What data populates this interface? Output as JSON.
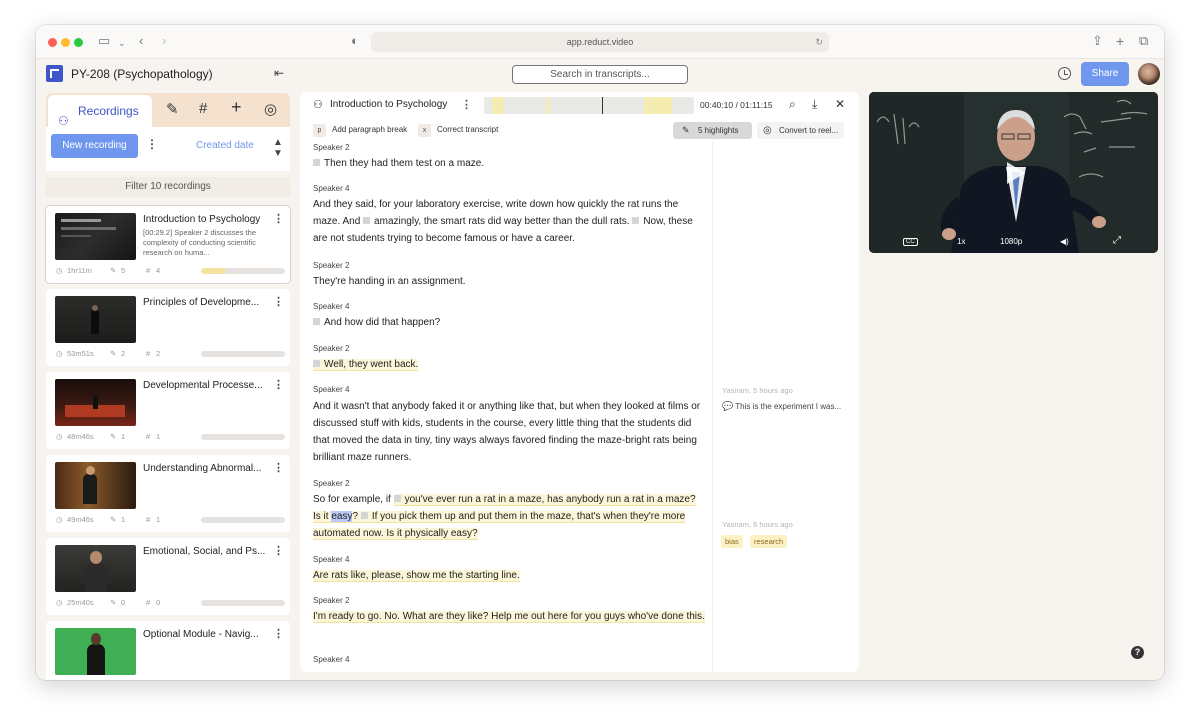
{
  "browser": {
    "url": "app.reduct.video"
  },
  "header": {
    "project_title": "PY-208 (Psychopathology)",
    "search_placeholder": "Search in transcripts...",
    "share_label": "Share"
  },
  "sidebar": {
    "tab_recordings": "Recordings",
    "new_recording": "New recording",
    "sort_label": "Created date",
    "filter_label": "Filter 10 recordings",
    "recordings": [
      {
        "title": "Introduction to Psychology",
        "desc": "[00:29.2] Speaker 2 discusses the complexity of conducting scientific research on huma...",
        "duration": "1hr11m",
        "highlights": "5",
        "tags": "4",
        "progress": 0.3
      },
      {
        "title": "Principles of Developme...",
        "duration": "53m51s",
        "highlights": "2",
        "tags": "2",
        "progress": 0.0
      },
      {
        "title": "Developmental Processe...",
        "duration": "48m46s",
        "highlights": "1",
        "tags": "1",
        "progress": 0.0
      },
      {
        "title": "Understanding Abnormal...",
        "duration": "49m46s",
        "highlights": "1",
        "tags": "1",
        "progress": 0.0
      },
      {
        "title": "Emotional, Social, and Ps...",
        "duration": "25m40s",
        "highlights": "0",
        "tags": "0",
        "progress": 0.0
      },
      {
        "title": "Optional Module - Navig..."
      }
    ]
  },
  "transcript": {
    "title": "Introduction to Psychology",
    "time": "00:40:10 / 01:11:15",
    "tool_paragraph_key": "p",
    "tool_paragraph": "Add paragraph break",
    "tool_correct_key": "x",
    "tool_correct": "Correct transcript",
    "highlights_btn": "5 highlights",
    "reel_btn": "Convert to reel...",
    "segments": [
      {
        "speaker": "Speaker 2",
        "text": "Then they had them test on a maze."
      },
      {
        "speaker": "Speaker 4",
        "text_a": "And they said, for your laboratory exercise, write down how quickly the rat runs the maze. And",
        "text_b": "amazingly, the smart rats did way better than the dull rats.",
        "text_c": "Now, these are not students trying to become famous or have a career."
      },
      {
        "speaker": "Speaker 2",
        "text": "They're handing in an assignment."
      },
      {
        "speaker": "Speaker 4",
        "text": "And how did that happen?"
      },
      {
        "speaker": "Speaker 2",
        "text": "Well, they went back."
      },
      {
        "speaker": "Speaker 4",
        "text": "And it wasn't that anybody faked it or anything like that, but when they looked at films or discussed stuff with kids, students in the course, every little thing that the students did that moved the data in tiny, tiny ways always favored finding the maze-bright rats being brilliant maze runners."
      },
      {
        "speaker": "Speaker 2",
        "text_a": "So for example, if",
        "text_b": "you've ever run a rat in a maze, has anybody run a rat in a maze? Is it",
        "text_sel": "easy",
        "text_c": "?",
        "text_d": "If you pick them up and put them in the maze, that's when they're more automated now. Is it physically easy?"
      },
      {
        "speaker": "Speaker 4",
        "text": "Are rats like, please, show me the starting line."
      },
      {
        "speaker": "Speaker 2",
        "text": "I'm ready to go. No. What are they like? Help me out here for you guys who've done this."
      },
      {
        "speaker": "Speaker 4",
        "text": ""
      }
    ]
  },
  "comments": [
    {
      "meta": "Yasnam, 5 hours ago",
      "text": "This is the experiment I was..."
    },
    {
      "meta": "Yasnam, 6 hours ago",
      "tags": [
        "bias",
        "research"
      ]
    }
  ],
  "video": {
    "cc": "CC",
    "speed": "1x",
    "quality": "1080p"
  },
  "help": "?"
}
